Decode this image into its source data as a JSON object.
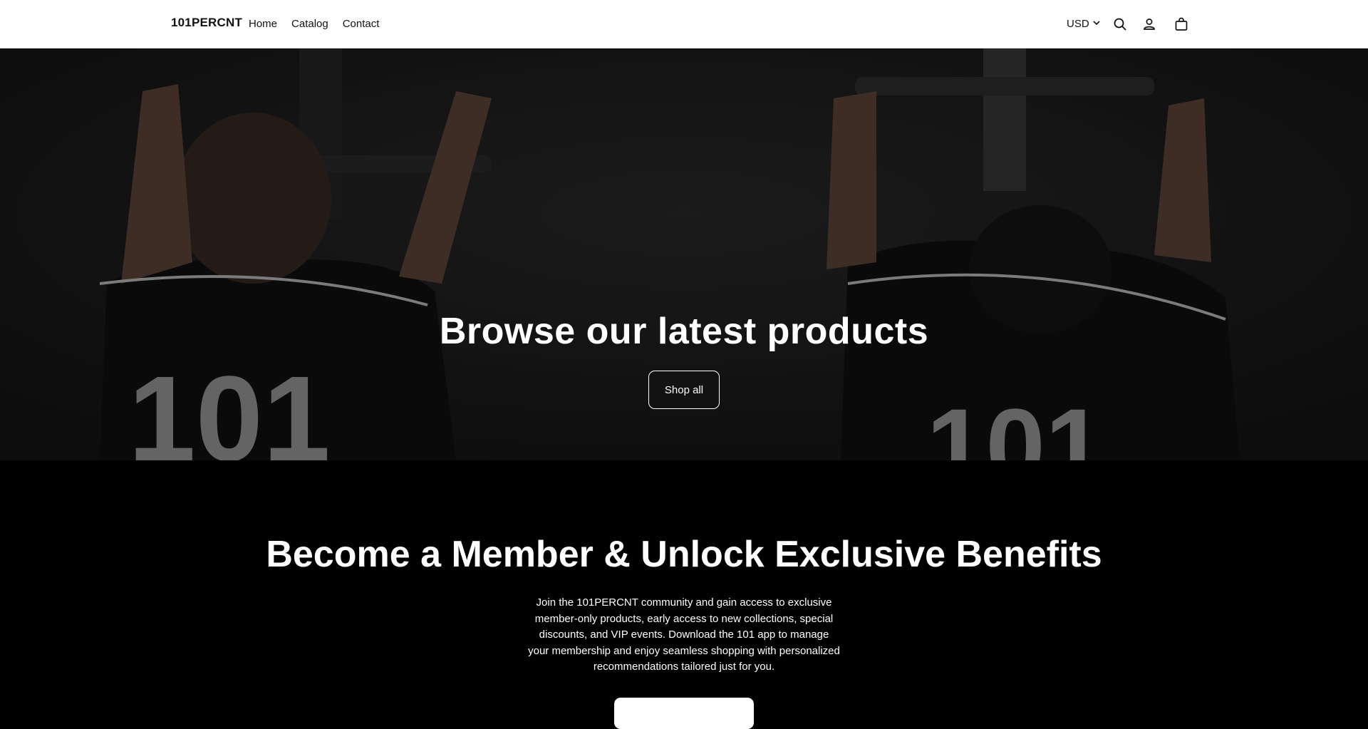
{
  "header": {
    "logo": "101PERCNT",
    "nav": [
      {
        "label": "Home"
      },
      {
        "label": "Catalog"
      },
      {
        "label": "Contact"
      }
    ],
    "currency": "USD",
    "icons": [
      "search-icon",
      "account-icon",
      "cart-icon"
    ]
  },
  "hero": {
    "title": "Browse our latest products",
    "button_label": "Shop all"
  },
  "member": {
    "title": "Become a Member & Unlock Exclusive Benefits",
    "text": "Join the 101PERCNT community and gain access to exclusive member-only products, early access to new collections, special discounts, and VIP events. Download the 101 app to manage your membership and enjoy seamless shopping with personalized recommendations tailored just for you.",
    "button_label": ""
  },
  "colors": {
    "header_bg": "#ffffff",
    "text_dark": "#121212",
    "hero_overlay": "#1c1c1c",
    "section_bg": "#000000",
    "text_light": "#ffffff"
  }
}
